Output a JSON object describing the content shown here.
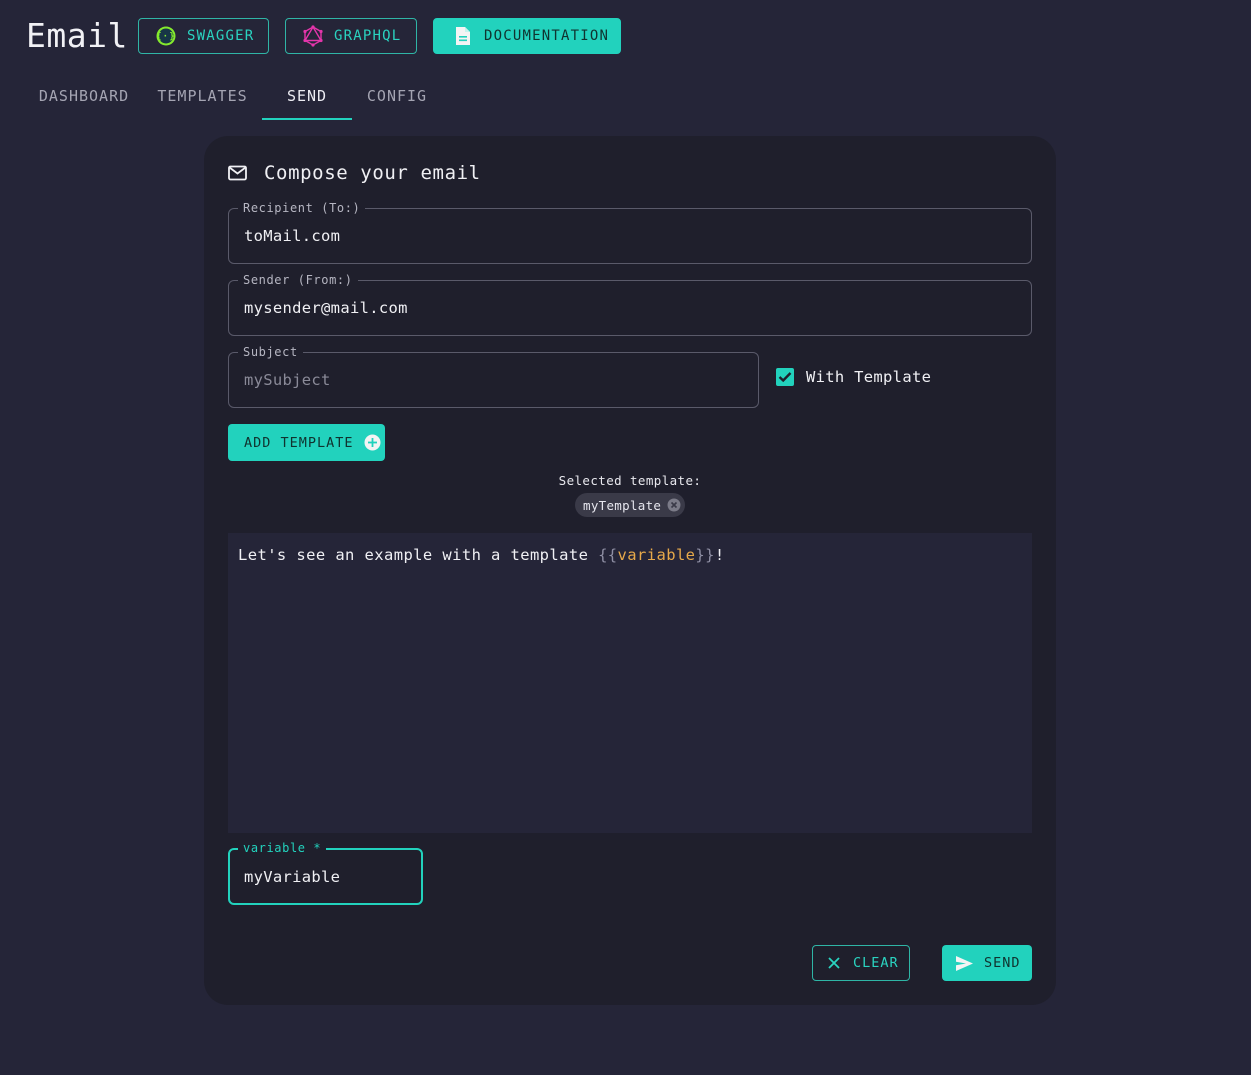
{
  "app": {
    "title": "Email"
  },
  "header_buttons": {
    "swagger": {
      "label": "SWAGGER",
      "icon": "swagger-icon"
    },
    "graphql": {
      "label": "GRAPHQL",
      "icon": "graphql-icon"
    },
    "documentation": {
      "label": "DOCUMENTATION",
      "icon": "document-icon"
    }
  },
  "tabs": [
    {
      "label": "DASHBOARD",
      "active": false
    },
    {
      "label": "TEMPLATES",
      "active": false
    },
    {
      "label": "SEND",
      "active": true
    },
    {
      "label": "CONFIG",
      "active": false
    }
  ],
  "compose": {
    "title": "Compose your email",
    "icon": "mail-icon",
    "recipient": {
      "label": "Recipient (To:)",
      "value": "toMail.com"
    },
    "sender": {
      "label": "Sender (From:)",
      "value": "mysender@mail.com"
    },
    "subject": {
      "label": "Subject",
      "placeholder": "mySubject",
      "value": ""
    },
    "with_template": {
      "label": "With Template",
      "checked": true
    },
    "add_template_label": "ADD TEMPLATE",
    "selected_template_label": "Selected template:",
    "selected_template": "myTemplate",
    "template_text": {
      "prefix": "Let's see an example with a template ",
      "open": "{{",
      "variable": "variable",
      "close": "}}",
      "suffix": "!"
    },
    "variable_field": {
      "label": "variable *",
      "value": "myVariable"
    },
    "clear_label": "CLEAR",
    "send_label": "SEND"
  },
  "colors": {
    "background": "#252538",
    "card": "#1f1f2c",
    "accent": "#22d2bd",
    "variable_highlight": "#e7a94a",
    "graphql_pink": "#e535ab",
    "swagger_green": "#85ea2d"
  }
}
